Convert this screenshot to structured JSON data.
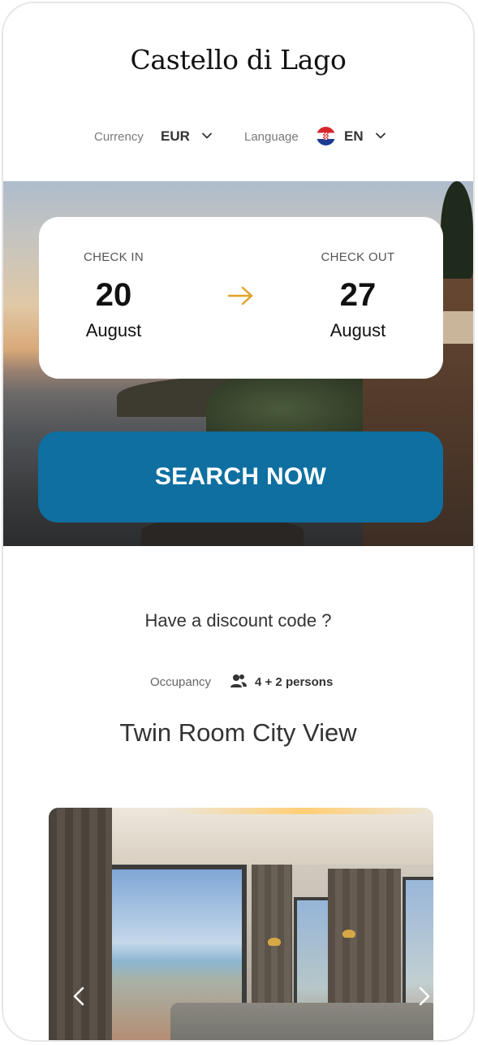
{
  "brand": {
    "name": "Castello di Lago"
  },
  "preferences": {
    "currency_label": "Currency",
    "currency_value": "EUR",
    "language_label": "Language",
    "language_value": "EN",
    "language_flag": "croatia-flag-icon"
  },
  "booking": {
    "check_in_label": "CHECK IN",
    "check_in_day": "20",
    "check_in_month": "August",
    "check_out_label": "CHECK OUT",
    "check_out_day": "27",
    "check_out_month": "August",
    "arrow_color": "#e0a326"
  },
  "search": {
    "button_label": "SEARCH NOW",
    "button_color": "#0e6fa0"
  },
  "discount": {
    "link_text": "Have a discount code ?"
  },
  "occupancy": {
    "label": "Occupancy",
    "value": "4 + 2 persons",
    "icon": "people-icon"
  },
  "room": {
    "title": "Twin Room City View"
  }
}
